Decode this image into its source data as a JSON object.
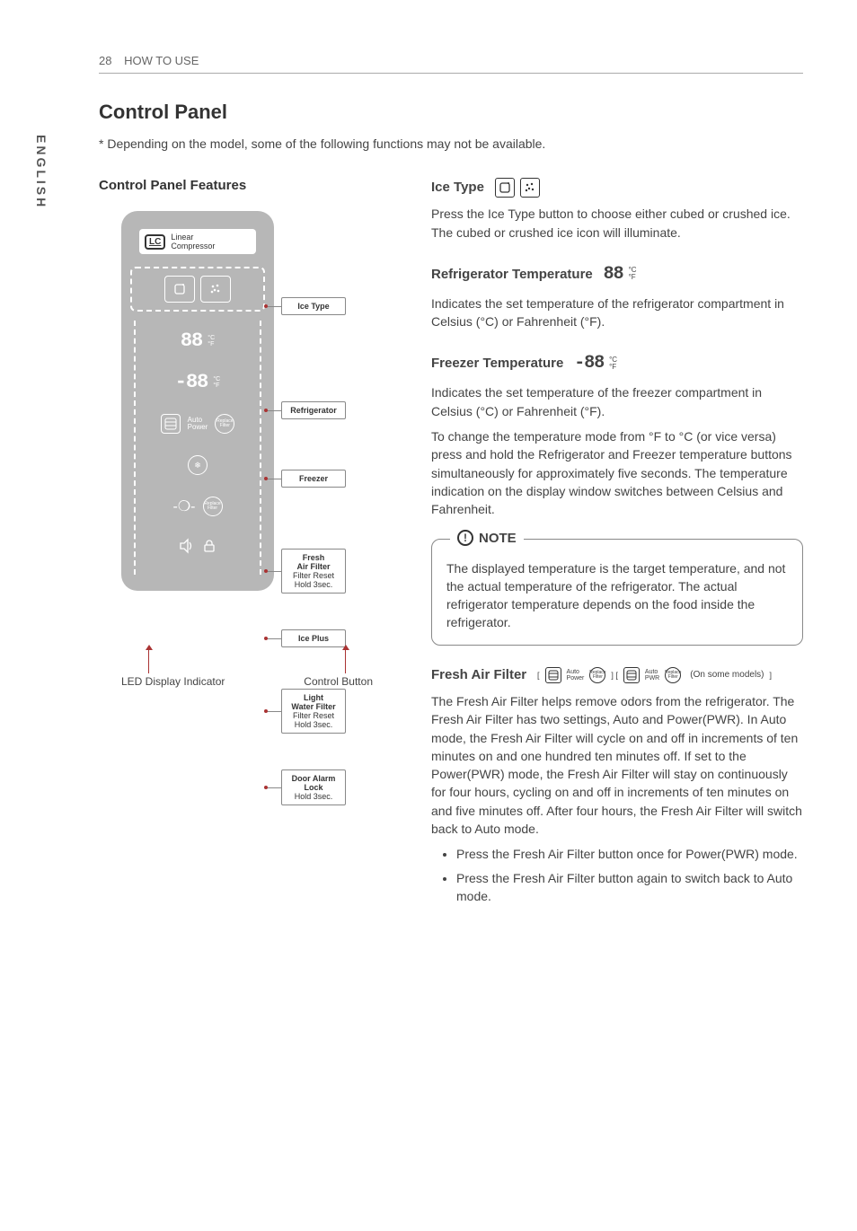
{
  "sidetab": "ENGLISH",
  "header": {
    "page_number": "28",
    "section": "HOW TO USE"
  },
  "title": "Control Panel",
  "asterisk_note": "* Depending on the model, some of the following functions may not be available.",
  "left": {
    "subhead": "Control Panel Features",
    "lc_badge": "LC",
    "lc_text1": "Linear",
    "lc_text2": "Compressor",
    "labels": {
      "ice_type": "Ice Type",
      "refrigerator": "Refrigerator",
      "freezer": "Freezer",
      "fresh_air_filter_l1": "Fresh",
      "fresh_air_filter_l2": "Air Filter",
      "fresh_air_filter_l3": "Filter Reset",
      "fresh_air_filter_l4": "Hold 3sec.",
      "ice_plus": "Ice Plus",
      "light_l1": "Light",
      "light_l2": "Water Filter",
      "light_l3": "Filter Reset",
      "light_l4": "Hold 3sec.",
      "door_alarm_l1": "Door Alarm",
      "door_alarm_l2": "Lock",
      "door_alarm_l3": "Hold 3sec."
    },
    "small_text": {
      "auto": "Auto",
      "power": "Power",
      "replace_filter": "Replace Filter"
    },
    "caption_left": "LED Display Indicator",
    "caption_right": "Control Button"
  },
  "right": {
    "ice_type": {
      "title": "Ice Type",
      "body": "Press the Ice Type button to choose either cubed or crushed ice. The cubed or crushed ice icon will illuminate."
    },
    "refrigerator_temp": {
      "title": "Refrigerator Temperature",
      "body": "Indicates the set temperature of the refrigerator compartment in Celsius (°C) or Fahrenheit (°F)."
    },
    "freezer_temp": {
      "title": "Freezer Temperature",
      "body1": "Indicates the set temperature of the freezer compartment in Celsius (°C) or Fahrenheit (°F).",
      "body2": "To change the temperature mode from °F to °C (or vice versa) press and hold the Refrigerator and Freezer temperature buttons simultaneously for approximately five seconds. The temperature indication on the display window switches between Celsius and Fahrenheit."
    },
    "note": {
      "label": "NOTE",
      "body": "The displayed temperature is the target temperature, and not the actual temperature of the refrigerator. The actual refrigerator temperature depends on the food inside the refrigerator."
    },
    "fresh_air": {
      "title": "Fresh Air Filter",
      "on_some": "(On some models)",
      "tiny_auto": "Auto",
      "tiny_power": "Power",
      "tiny_pwr": "PWR",
      "tiny_replace": "Replace Filter",
      "body": "The Fresh Air Filter helps remove odors from the refrigerator. The Fresh Air Filter has two settings, Auto and Power(PWR). In Auto mode, the Fresh Air Filter will cycle on and off in increments of ten minutes on and one hundred ten minutes off. If set to the Power(PWR) mode, the Fresh Air Filter will stay on continuously for four hours, cycling on and off in increments of ten minutes on and five minutes off. After four hours, the Fresh Air Filter will switch back to Auto mode.",
      "bullet1": "Press the Fresh Air Filter button once for Power(PWR) mode.",
      "bullet2": "Press the Fresh Air Filter button again to switch back to Auto mode."
    },
    "units": {
      "c": "°C",
      "f": "°F"
    },
    "digits": {
      "pos88": "88",
      "neg88": "-88"
    }
  }
}
